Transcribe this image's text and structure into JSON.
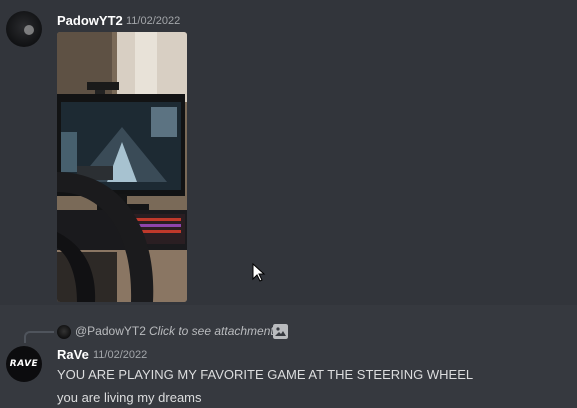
{
  "messages": [
    {
      "author": "PadowYT2",
      "timestamp": "11/02/2022",
      "avatar_icon": "dark-profile-avatar",
      "attachment_icon": "video-of-racing-game-with-steering-wheel"
    },
    {
      "author": "RaVe",
      "timestamp": "11/02/2022",
      "avatar_icon": "rave-logo-avatar",
      "avatar_logo_text": "RAVE",
      "reply": {
        "mention": "@PadowYT2",
        "link_text": "Click to see attachment",
        "icon": "image-icon"
      },
      "lines": [
        "YOU ARE PLAYING MY FAVORITE GAME AT THE STEERING WHEEL",
        "you are living my dreams"
      ]
    }
  ],
  "colors": {
    "background": "#36393f",
    "hover_background": "#32353b",
    "username": "#ffffff",
    "timestamp": "#a3a6aa",
    "text": "#dcddde"
  }
}
